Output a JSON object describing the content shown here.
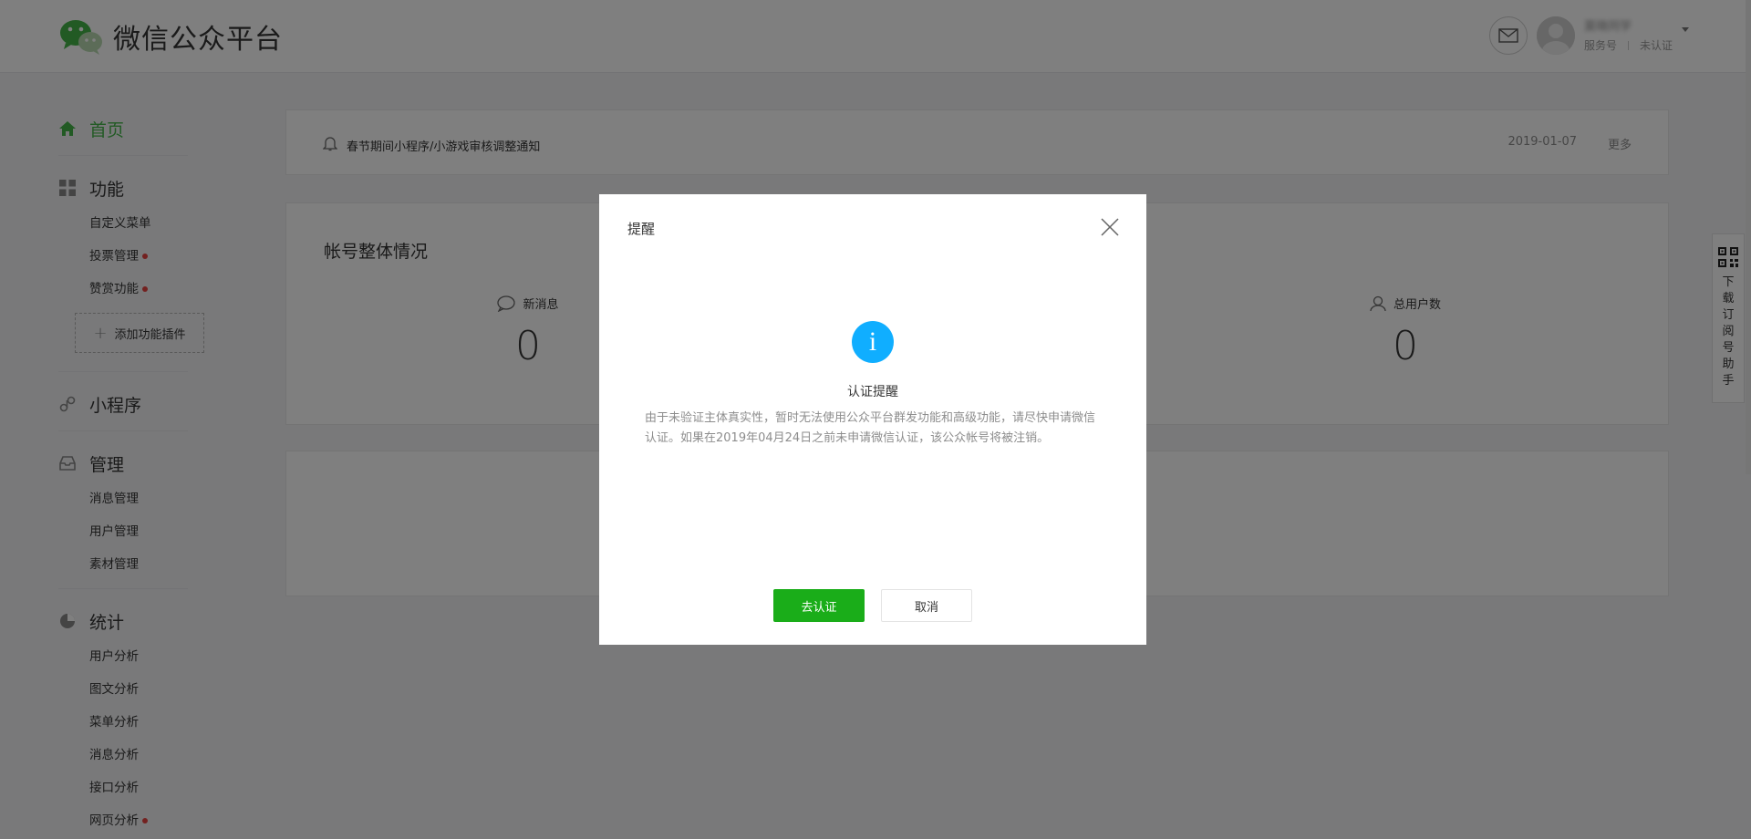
{
  "header": {
    "brand_title": "微信公众平台",
    "account_name": "莫晓同学",
    "account_type": "服务号",
    "account_status": "未认证"
  },
  "sidebar": {
    "home": "首页",
    "features": {
      "label": "功能",
      "items": [
        {
          "label": "自定义菜单"
        },
        {
          "label": "投票管理"
        },
        {
          "label": "赞赏功能"
        }
      ],
      "add_plugin": "添加功能插件"
    },
    "miniprogram": "小程序",
    "manage": {
      "label": "管理",
      "items": [
        {
          "label": "消息管理"
        },
        {
          "label": "用户管理"
        },
        {
          "label": "素材管理"
        }
      ]
    },
    "stats": {
      "label": "统计",
      "items": [
        {
          "label": "用户分析"
        },
        {
          "label": "图文分析"
        },
        {
          "label": "菜单分析"
        },
        {
          "label": "消息分析"
        },
        {
          "label": "接口分析"
        },
        {
          "label": "网页分析"
        }
      ]
    }
  },
  "notice": {
    "text": "春节期间小程序/小游戏审核调整通知",
    "date": "2019-01-07",
    "more": "更多"
  },
  "overview": {
    "title": "帐号整体情况",
    "new_messages_label": "新消息",
    "new_messages_value": "0",
    "total_users_label": "总用户数",
    "total_users_value": "0"
  },
  "float_helper": {
    "text": "下载订阅号助手"
  },
  "dialog": {
    "title": "提醒",
    "heading": "认证提醒",
    "body": "由于未验证主体真实性，暂时无法使用公众平台群发功能和高级功能，请尽快申请微信认证。如果在2019年04月24日之前未申请微信认证，该公众帐号将被注销。",
    "confirm": "去认证",
    "cancel": "取消"
  },
  "colors": {
    "brand_green": "#44b549",
    "primary_button": "#1aad19",
    "info_blue": "#10aeff",
    "badge_red": "#e64340"
  }
}
